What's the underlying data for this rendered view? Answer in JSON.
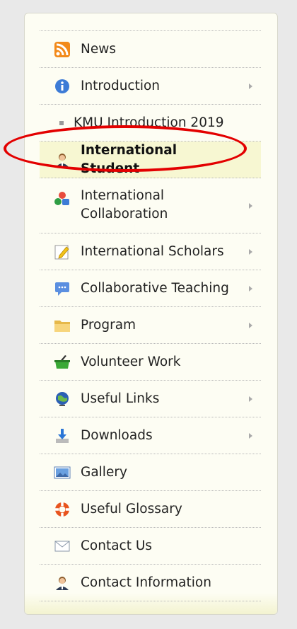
{
  "menu": {
    "items": [
      {
        "label": "News",
        "icon": "rss-icon",
        "has_submenu": false
      },
      {
        "label": "Introduction",
        "icon": "info-icon",
        "has_submenu": true
      },
      {
        "label": "KMU Introduction 2019",
        "icon": "bullet",
        "has_submenu": false
      },
      {
        "label": "International Student",
        "icon": "person-icon",
        "has_submenu": false,
        "active": true
      },
      {
        "label": "International Collaboration",
        "icon": "shapes-icon",
        "has_submenu": true
      },
      {
        "label": "International Scholars",
        "icon": "edit-icon",
        "has_submenu": true
      },
      {
        "label": "Collaborative Teaching",
        "icon": "chat-icon",
        "has_submenu": true
      },
      {
        "label": "Program",
        "icon": "folder-icon",
        "has_submenu": true
      },
      {
        "label": "Volunteer Work",
        "icon": "basket-icon",
        "has_submenu": false
      },
      {
        "label": "Useful Links",
        "icon": "globe-icon",
        "has_submenu": true
      },
      {
        "label": "Downloads",
        "icon": "download-icon",
        "has_submenu": true
      },
      {
        "label": "Gallery",
        "icon": "image-icon",
        "has_submenu": false
      },
      {
        "label": "Useful Glossary",
        "icon": "lifebuoy-icon",
        "has_submenu": false
      },
      {
        "label": "Contact Us",
        "icon": "mail-icon",
        "has_submenu": false
      },
      {
        "label": "Contact Information",
        "icon": "person-icon",
        "has_submenu": false
      }
    ]
  },
  "colors": {
    "highlight_ring": "#e30000",
    "panel_bg": "#fdfdf3",
    "active_bg": "#f7f7d2"
  }
}
